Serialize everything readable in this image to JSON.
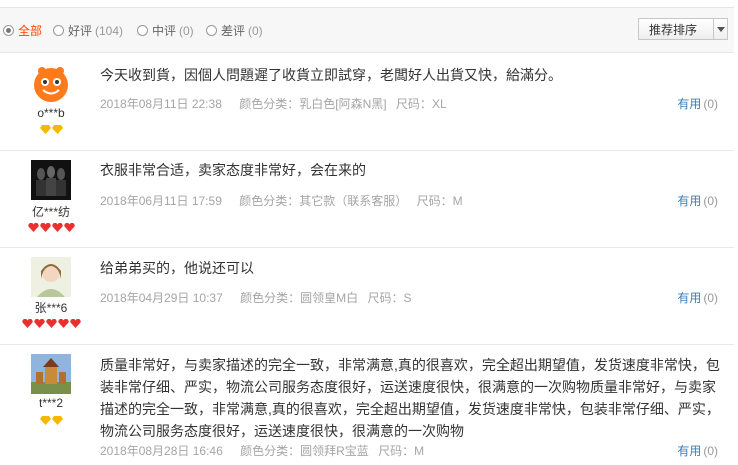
{
  "filters": [
    {
      "label": "全部",
      "count": ""
    },
    {
      "label": "好评",
      "count": "(104)"
    },
    {
      "label": "中评",
      "count": "(0)"
    },
    {
      "label": "差评",
      "count": "(0)"
    }
  ],
  "sort": {
    "label": "推荐排序"
  },
  "reviews": [
    {
      "user": "o***b",
      "avatar_icon": "orange-cartoon-avatar",
      "text": "今天收到貨，因個人問題遲了收貨立即試穿，老闆好人出貨又快，給滿分。",
      "date": "2018年08月11日 22:38",
      "color_label": "颜色分类：",
      "color": "乳白色[阿森N黑]",
      "size_label": "尺码：",
      "size": "XL",
      "useful_label": "有用",
      "useful_count": "(0)",
      "badge_count": 2,
      "badge_color": "#f5b800"
    },
    {
      "user": "亿***纺",
      "avatar_icon": "dark-figures-avatar",
      "text": "衣服非常合适，卖家态度非常好，会在来的",
      "date": "2018年06月11日 17:59",
      "color_label": "颜色分类：",
      "color": "其它款（联系客服）",
      "size_label": "尺码：",
      "size": "M",
      "useful_label": "有用",
      "useful_count": "(0)",
      "badge_count": 4,
      "badge_color": "#e8312f"
    },
    {
      "user": "张***6",
      "avatar_icon": "girl-portrait-avatar",
      "text": "给弟弟买的，他说还可以",
      "date": "2018年04月29日 10:37",
      "color_label": "颜色分类：",
      "color": "圆领皇M白",
      "size_label": "尺码：",
      "size": "S",
      "useful_label": "有用",
      "useful_count": "(0)",
      "badge_count": 5,
      "badge_color": "#e8312f"
    },
    {
      "user": "t***2",
      "avatar_icon": "castle-landscape-avatar",
      "text": "质量非常好，与卖家描述的完全一致，非常满意,真的很喜欢，完全超出期望值，发货速度非常快，包装非常仔细、严实，物流公司服务态度很好，运送速度很快，很满意的一次购物质量非常好，与卖家描述的完全一致，非常满意,真的很喜欢，完全超出期望值，发货速度非常快，包装非常仔细、严实，物流公司服务态度很好，运送速度很快，很满意的一次购物",
      "date": "2018年08月28日 16:46",
      "color_label": "颜色分类：",
      "color": "圆领拜R宝蓝",
      "size_label": "尺码：",
      "size": "M",
      "useful_label": "有用",
      "useful_count": "(0)",
      "badge_count": 2,
      "badge_color": "#f5b800"
    }
  ]
}
